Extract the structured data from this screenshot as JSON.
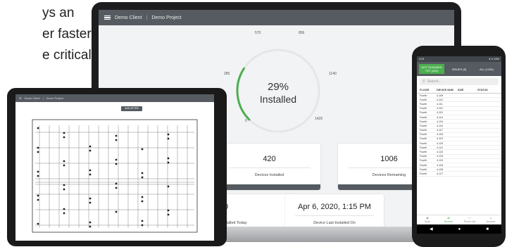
{
  "marketing": {
    "lines": [
      "ys an",
      "er faster,",
      "e critical"
    ]
  },
  "laptop": {
    "header": {
      "client": "Demo Client",
      "project": "Demo Project"
    },
    "gauge": {
      "percent_text": "29%",
      "label": "Installed",
      "progress_fraction": 0.29,
      "ticks": [
        "285",
        "570",
        "856",
        "1140",
        "1426",
        "0"
      ]
    },
    "cards": [
      {
        "value": "420",
        "label": "Devices Installed"
      },
      {
        "value": "1006",
        "label": "Devices Remaining"
      },
      {
        "value": "0",
        "label": "Installed Today"
      },
      {
        "value": "Apr 6, 2020, 1:15 PM",
        "label": "Device Last Installed On"
      }
    ],
    "colors": {
      "accent": "#4caf50",
      "topbar": "#555b60"
    }
  },
  "tablet": {
    "header": {
      "client": "Demo Client",
      "project": "Demo Project"
    },
    "button_label": "ADD AFTER"
  },
  "phone": {
    "status": {
      "time": "4:21",
      "signal": "▾ 4 13%"
    },
    "tabs": [
      "NOT SCANNED YET (420)",
      "ISSUES (9)",
      "ALL (1425)"
    ],
    "search_placeholder": "Search...",
    "columns": [
      "FLOOR",
      "DEVICE NUM",
      "SIZE",
      "STATUS"
    ],
    "rows": [
      [
        "Fourth",
        "4-109"
      ],
      [
        "Fourth",
        "4-110"
      ],
      [
        "Fourth",
        "4-111"
      ],
      [
        "Fourth",
        "4-112"
      ],
      [
        "Fourth",
        "4-113"
      ],
      [
        "Fourth",
        "4-114"
      ],
      [
        "Fourth",
        "4-115"
      ],
      [
        "Fourth",
        "4-116"
      ],
      [
        "Fourth",
        "4-117"
      ],
      [
        "Fourth",
        "4-118"
      ],
      [
        "Fourth",
        "4-119"
      ],
      [
        "Fourth",
        "4-120"
      ],
      [
        "Fourth",
        "4-121"
      ],
      [
        "Fourth",
        "4-122"
      ],
      [
        "Fourth",
        "4-123"
      ],
      [
        "Fourth",
        "4-124"
      ],
      [
        "Fourth",
        "4-125"
      ],
      [
        "Fourth",
        "4-126"
      ],
      [
        "Fourth",
        "4-127"
      ]
    ],
    "nav": [
      "Scan",
      "Devices",
      "Punch List",
      "Account"
    ]
  }
}
